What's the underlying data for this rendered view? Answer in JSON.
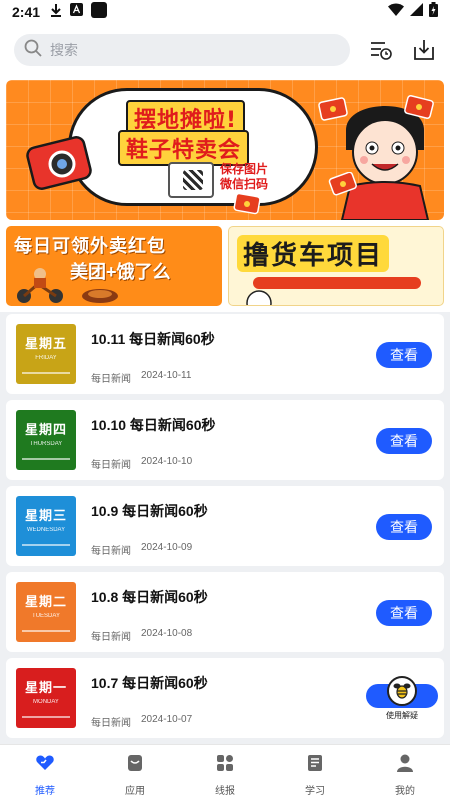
{
  "status_bar": {
    "time": "2:41"
  },
  "header": {
    "search_placeholder": "搜索"
  },
  "banners": {
    "main": {
      "title_line1": "摆地摊啦!",
      "title_line2": "鞋子特卖会",
      "save_line1": "保存图片",
      "save_line2": "微信扫码"
    },
    "left": {
      "line1": "每日可领外卖红包",
      "line2": "美团+饿了么"
    },
    "right": {
      "title": "撸货车项目"
    }
  },
  "news": [
    {
      "title": "10.11 每日新闻60秒",
      "source": "每日新闻",
      "date": "2024-10-11",
      "thumb_cn": "星期五",
      "thumb_en": "FRIDAY",
      "color": "#c8a417",
      "action": "查看"
    },
    {
      "title": "10.10 每日新闻60秒",
      "source": "每日新闻",
      "date": "2024-10-10",
      "thumb_cn": "星期四",
      "thumb_en": "THURSDAY",
      "color": "#1f7a1f",
      "action": "查看"
    },
    {
      "title": "10.9 每日新闻60秒",
      "source": "每日新闻",
      "date": "2024-10-09",
      "thumb_cn": "星期三",
      "thumb_en": "WEDNESDAY",
      "color": "#1e8fd8",
      "action": "查看"
    },
    {
      "title": "10.8 每日新闻60秒",
      "source": "每日新闻",
      "date": "2024-10-08",
      "thumb_cn": "星期二",
      "thumb_en": "TUESDAY",
      "color": "#f0792a",
      "action": "查看"
    },
    {
      "title": "10.7 每日新闻60秒",
      "source": "每日新闻",
      "date": "2024-10-07",
      "thumb_cn": "星期一",
      "thumb_en": "MONDAY",
      "color": "#d81e1e",
      "action": "查看"
    }
  ],
  "help_button": {
    "label": "使用解疑"
  },
  "bottom_nav": [
    {
      "label": "推荐",
      "icon": "heart-icon",
      "active": true
    },
    {
      "label": "应用",
      "icon": "apps-icon",
      "active": false
    },
    {
      "label": "线报",
      "icon": "grid-icon",
      "active": false
    },
    {
      "label": "学习",
      "icon": "book-icon",
      "active": false
    },
    {
      "label": "我的",
      "icon": "person-icon",
      "active": false
    }
  ],
  "colors": {
    "accent": "#1f5bff"
  }
}
